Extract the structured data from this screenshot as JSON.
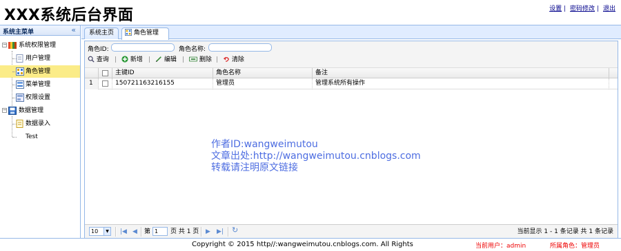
{
  "header": {
    "title": "XXX系统后台界面",
    "links": [
      "设置",
      "密码修改",
      "退出"
    ]
  },
  "sidebar": {
    "title": "系统主菜单",
    "collapse_glyph": "«",
    "groups": [
      {
        "label": "系统权限管理",
        "expanded": true,
        "items": [
          {
            "label": "用户管理",
            "selected": false
          },
          {
            "label": "角色管理",
            "selected": true
          },
          {
            "label": "菜单管理",
            "selected": false
          },
          {
            "label": "权限设置",
            "selected": false
          }
        ]
      },
      {
        "label": "数据管理",
        "expanded": true,
        "items": [
          {
            "label": "数据录入",
            "selected": false
          },
          {
            "label": "Test",
            "selected": false
          }
        ]
      }
    ]
  },
  "tabs": [
    {
      "label": "系统主页",
      "active": false,
      "closable": false
    },
    {
      "label": "角色管理",
      "active": true,
      "closable": true,
      "close_glyph": "×"
    }
  ],
  "search": {
    "role_id_label": "角色ID:",
    "role_id_value": "",
    "role_name_label": "角色名称:",
    "role_name_value": ""
  },
  "toolbar": {
    "query": "查询",
    "add": "新增",
    "edit": "编辑",
    "delete": "删除",
    "clear": "清除",
    "separator": "|"
  },
  "grid": {
    "columns": [
      "主键ID",
      "角色名称",
      "备注"
    ],
    "rows": [
      {
        "index": "1",
        "checked": false,
        "cells": [
          "150721163216155",
          "管理员",
          "管理系统所有操作"
        ]
      }
    ]
  },
  "watermark": {
    "line1": "作者ID:wangweimutou",
    "line2": "文章出处:http://wangweimutou.cnblogs.com",
    "line3": "转载请注明原文链接"
  },
  "pager": {
    "page_size": "10",
    "page_prefix": "第",
    "page_value": "1",
    "page_suffix": "页 共 1 页",
    "summary": "当前显示 1 - 1 条记录 共 1 条记录"
  },
  "footer": {
    "copyright": "Copyright © 2015 http//:wangweimutou.cnblogs.com. All Rights",
    "current_user": "当前用户：admin",
    "current_role": "所属角色：管理员"
  },
  "colors": {
    "accent_border": "#95b8e7",
    "selected_row": "#fbec88",
    "watermark": "#4d6de1",
    "footer_status": "#ee0000"
  }
}
